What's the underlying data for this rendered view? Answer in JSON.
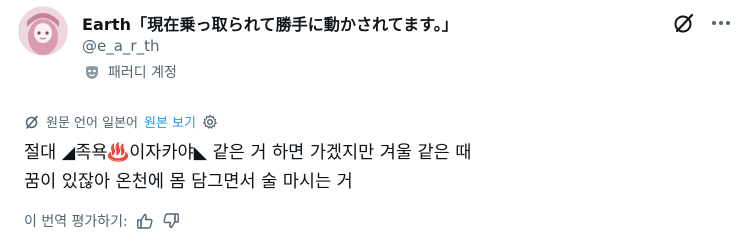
{
  "author": {
    "display_name": "Earth「現在乗っ取られて勝手に動かされてます。」",
    "handle": "@e_a_r_th",
    "parody_label": "패러디 계정"
  },
  "translation": {
    "original_language_text": "원문 언어 일본어",
    "show_original_link": "원본 보기"
  },
  "tweet": {
    "text": "절대 ◢족욕♨️이자카야◣ 같은 거 하면 가겠지만 겨울 같은 때\n꿈이 있잖아 온천에 몸 담그면서 술 마시는 거"
  },
  "rating": {
    "label": "이 번역 평가하기:"
  },
  "icons": {
    "grok": "grok-icon",
    "more": "more-options-icon",
    "parody": "parody-mask-icon",
    "translate": "translate-icon",
    "settings": "gear-icon",
    "thumbs_up": "thumbs-up-icon",
    "thumbs_down": "thumbs-down-icon"
  },
  "colors": {
    "text_primary": "#0f1419",
    "text_secondary": "#536471",
    "link_blue": "#1d9bf0"
  }
}
